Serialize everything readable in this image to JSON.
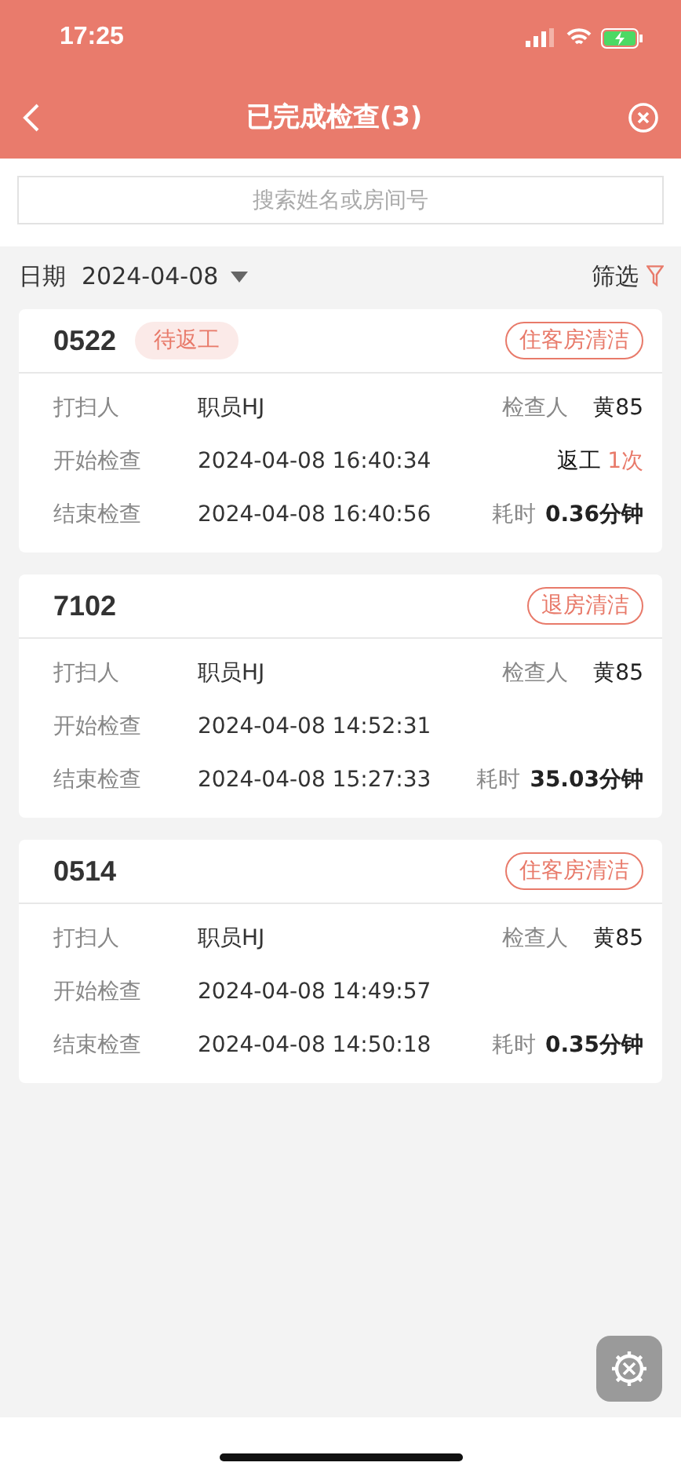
{
  "status_bar": {
    "time": "17:25"
  },
  "nav": {
    "title": "已完成检查(3)"
  },
  "search": {
    "placeholder": "搜索姓名或房间号"
  },
  "date_bar": {
    "label": "日期",
    "date": "2024-04-08",
    "filter": "筛选"
  },
  "cards": [
    {
      "room": "0522",
      "badge": "待返工",
      "type": "住客房清洁",
      "cleaner_label": "打扫人",
      "cleaner": "职员HJ",
      "inspector_label": "检查人",
      "inspector": "黄85",
      "start_label": "开始检查",
      "start": "2024-04-08 16:40:34",
      "rework_label": "返工",
      "rework_count": "1次",
      "end_label": "结束检查",
      "end": "2024-04-08 16:40:56",
      "duration_label": "耗时",
      "duration": "0.36分钟"
    },
    {
      "room": "7102",
      "type": "退房清洁",
      "cleaner_label": "打扫人",
      "cleaner": "职员HJ",
      "inspector_label": "检查人",
      "inspector": "黄85",
      "start_label": "开始检查",
      "start": "2024-04-08 14:52:31",
      "end_label": "结束检查",
      "end": "2024-04-08 15:27:33",
      "duration_label": "耗时",
      "duration": "35.03分钟"
    },
    {
      "room": "0514",
      "type": "住客房清洁",
      "cleaner_label": "打扫人",
      "cleaner": "职员HJ",
      "inspector_label": "检查人",
      "inspector": "黄85",
      "start_label": "开始检查",
      "start": "2024-04-08 14:49:57",
      "end_label": "结束检查",
      "end": "2024-04-08 14:50:18",
      "duration_label": "耗时",
      "duration": "0.35分钟"
    }
  ]
}
